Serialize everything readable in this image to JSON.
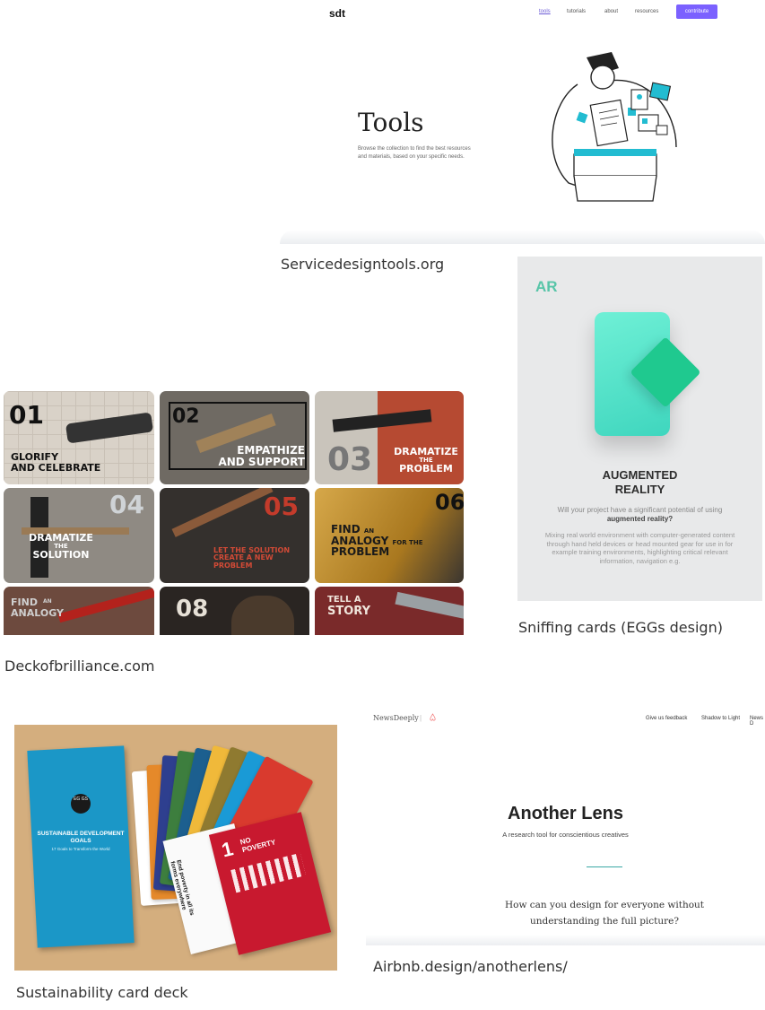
{
  "sdt": {
    "logo": "sdt",
    "nav": [
      "tools",
      "tutorials",
      "about",
      "resources"
    ],
    "contribute": "contribute",
    "title": "Tools",
    "description": "Browse the collection to find the best resources and materials, based on your specific needs.",
    "caption": "Servicedesigntools.org"
  },
  "sniffing": {
    "badge": "AR",
    "heading_line1": "AUGMENTED",
    "heading_line2": "REALITY",
    "question_pre": "Will your project have a significant potential of using ",
    "question_bold": "augmented reality?",
    "body": "Mixing real world environment with computer-generated content through hand held devices or head mounted gear for use in for example training environments, highlighting critical relevant information, navigation e.g.",
    "caption": "Sniffing  cards (EGGs design)"
  },
  "deck": {
    "caption": "Deckofbrilliance.com",
    "cards": [
      {
        "num": "01",
        "label1": "GLORIFY",
        "label2": "AND CELEBRATE"
      },
      {
        "num": "02",
        "label1": "EMPATHIZE",
        "label2": "AND SUPPORT"
      },
      {
        "num": "03",
        "label1": "DRAMATIZE",
        "label2": "PROBLEM",
        "small": "THE"
      },
      {
        "num": "04",
        "label1": "DRAMATIZE",
        "label2": "SOLUTION",
        "small": "THE"
      },
      {
        "num": "05",
        "label1": "LET THE SOLUTION",
        "label2": "CREATE A NEW PROBLEM"
      },
      {
        "num": "06",
        "label1": "FIND",
        "label2": "ANALOGY",
        "label3": "PROBLEM",
        "small1": "AN",
        "small2": "FOR THE"
      },
      {
        "num": "",
        "label1": "FIND",
        "label2": "ANALOGY",
        "small": "AN"
      },
      {
        "num": "08",
        "label1": "",
        "label2": ""
      },
      {
        "num": "",
        "label1": "TELL A",
        "label2": "STORY"
      }
    ]
  },
  "sdg": {
    "eggs": "EG GS",
    "title": "SUSTAINABLE DEVELOPMENT GOALS",
    "subtitle": "17 Goals to Transform the World",
    "card_num": "1",
    "card_title": "NO POVERTY",
    "card_text": "End poverty in all its forms everywhere",
    "caption": "Sustainability card deck"
  },
  "lens": {
    "brand": "NewsDeeply",
    "separator": "|",
    "nav": [
      "Give us feedback",
      "Shadow to Light",
      "News D"
    ],
    "title": "Another Lens",
    "subtitle": "A research tool for conscientious creatives",
    "question": "How can you design for everyone without understanding the full picture?",
    "caption": "Airbnb.design/anotherlens/"
  }
}
